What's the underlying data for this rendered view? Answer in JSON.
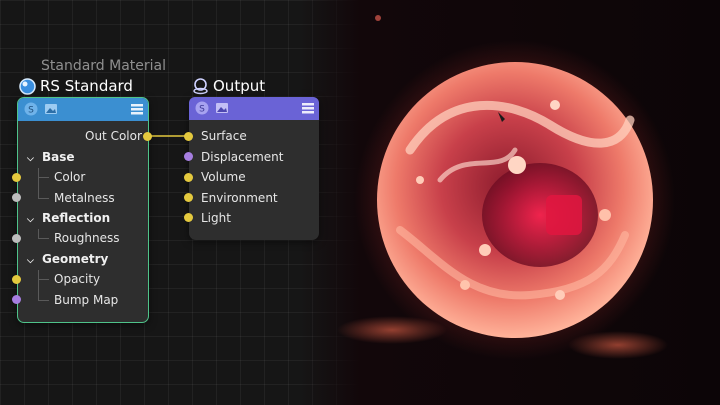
{
  "render_view": {
    "colors": {
      "background": "#0c0507",
      "orb_core": "#ff6a5c",
      "orb_glow": "#e03a35",
      "inner_red": "#d4113a"
    }
  },
  "material_node": {
    "subtitle": "Standard Material",
    "title": "RS Standard",
    "header_color": "#3b8fd1",
    "border_color": "#4fc38a",
    "output_port": "Out Color",
    "groups": [
      {
        "label": "Base",
        "inputs": [
          "Color",
          "Metalness"
        ]
      },
      {
        "label": "Reflection",
        "inputs": [
          "Roughness"
        ]
      },
      {
        "label": "Geometry",
        "inputs": [
          "Opacity",
          "Bump Map"
        ]
      }
    ]
  },
  "output_node": {
    "title": "Output",
    "header_color": "#6a63d6",
    "inputs": [
      "Surface",
      "Displacement",
      "Volume",
      "Environment",
      "Light"
    ]
  },
  "port_colors": {
    "yellow": "#e4c93e",
    "gray": "#bdbdbd",
    "purple": "#a67ee0"
  }
}
